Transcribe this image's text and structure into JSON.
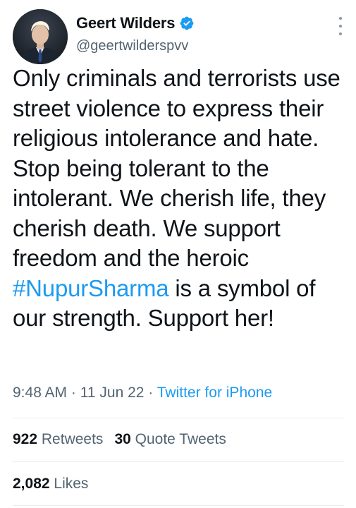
{
  "tweet": {
    "author": {
      "display_name": "Geert Wilders",
      "handle": "@geertwilderspvv",
      "verified": true,
      "avatar_icon": "profile-photo"
    },
    "text_segments": [
      {
        "text": "Only criminals and terrorists use street violence to express their religious intolerance and hate. Stop being tolerant to the intolerant. We cherish life, they cherish death. We support freedom and the heroic ",
        "type": "plain"
      },
      {
        "text": "#NupurSharma",
        "type": "hashtag"
      },
      {
        "text": " is a symbol of our strength. Support her!",
        "type": "plain"
      }
    ],
    "time": "9:48 AM",
    "separator": "·",
    "date": "11 Jun 22",
    "source": "Twitter for iPhone",
    "stats": {
      "retweets_count": "922",
      "retweets_label": "Retweets",
      "quotes_count": "30",
      "quotes_label": "Quote Tweets",
      "likes_count": "2,082",
      "likes_label": "Likes"
    }
  },
  "colors": {
    "link_blue": "#1d9bf0",
    "secondary_text": "#536471",
    "primary_text": "#0f1419",
    "divider": "#e6ecf0"
  }
}
